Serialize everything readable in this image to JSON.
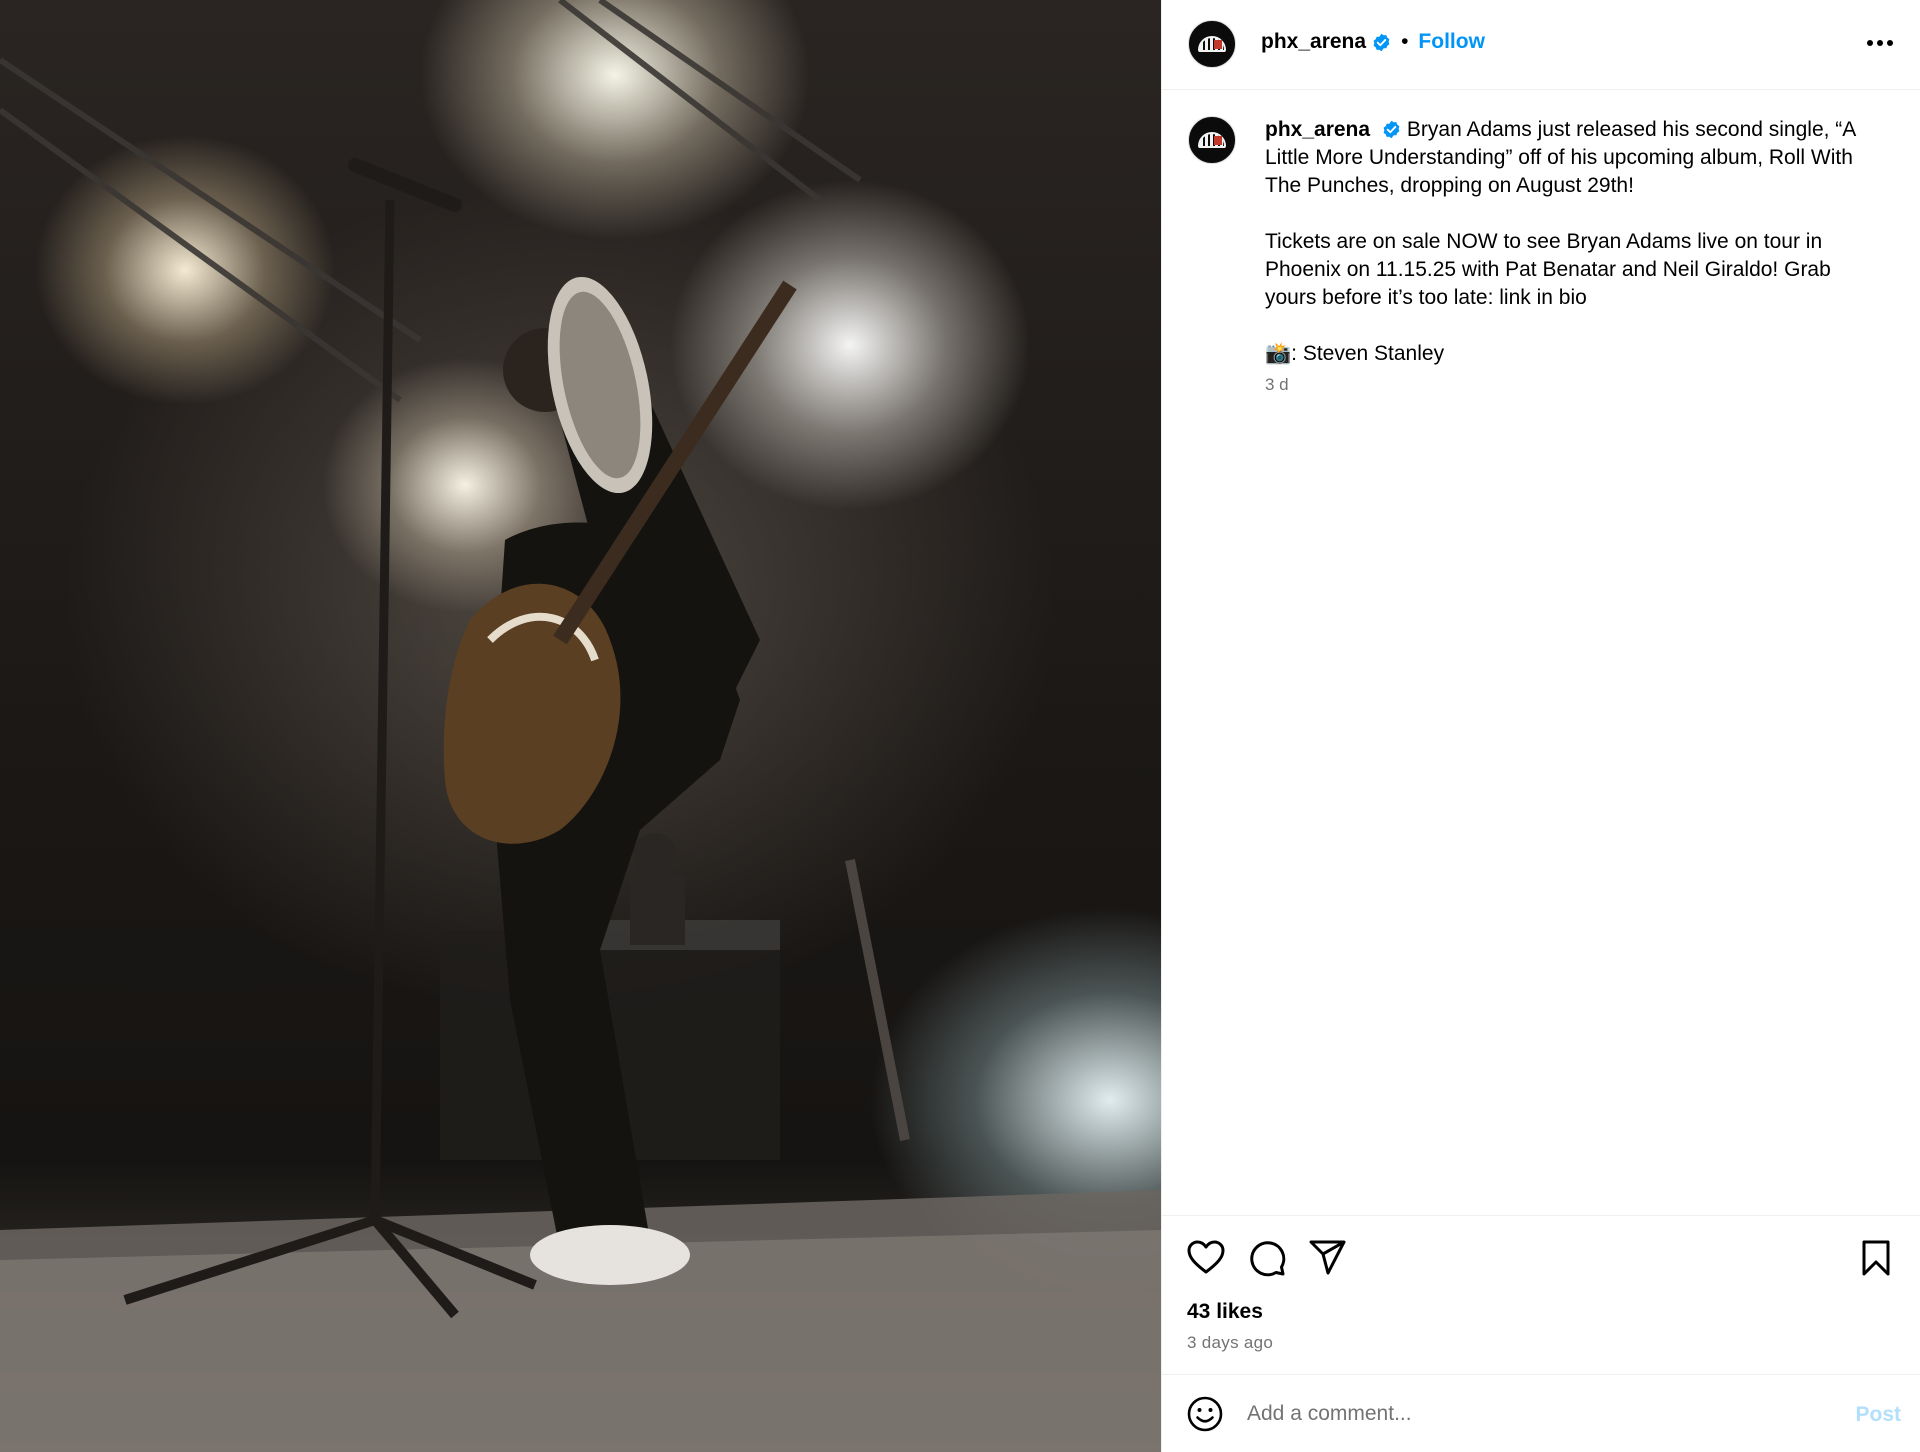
{
  "photo": {
    "description_icon": "concert-photo"
  },
  "header": {
    "username": "phx_arena",
    "separator": "•",
    "follow_label": "Follow"
  },
  "caption": {
    "username": "phx_arena",
    "paragraph_1": "Bryan Adams just released his second single, “A Little More Understanding” off of his upcoming album, Roll With The Punches, dropping on August 29th!",
    "paragraph_2": "Tickets are on sale NOW to see Bryan Adams live on tour in Phoenix on 11.15.25 with Pat Benatar and Neil Giraldo! Grab yours before it’s too late: link in bio",
    "credit_emoji": "📸",
    "credit_text": ": Steven Stanley",
    "time": "3 d"
  },
  "actions": {
    "likes": "43 likes",
    "posted_ago": "3 days ago"
  },
  "comment": {
    "placeholder": "Add a comment...",
    "post_label": "Post"
  },
  "colors": {
    "follow_blue": "#0095f6",
    "verified_blue": "#0095f6",
    "post_disabled": "#b2dffc",
    "secondary_text": "#737373"
  }
}
